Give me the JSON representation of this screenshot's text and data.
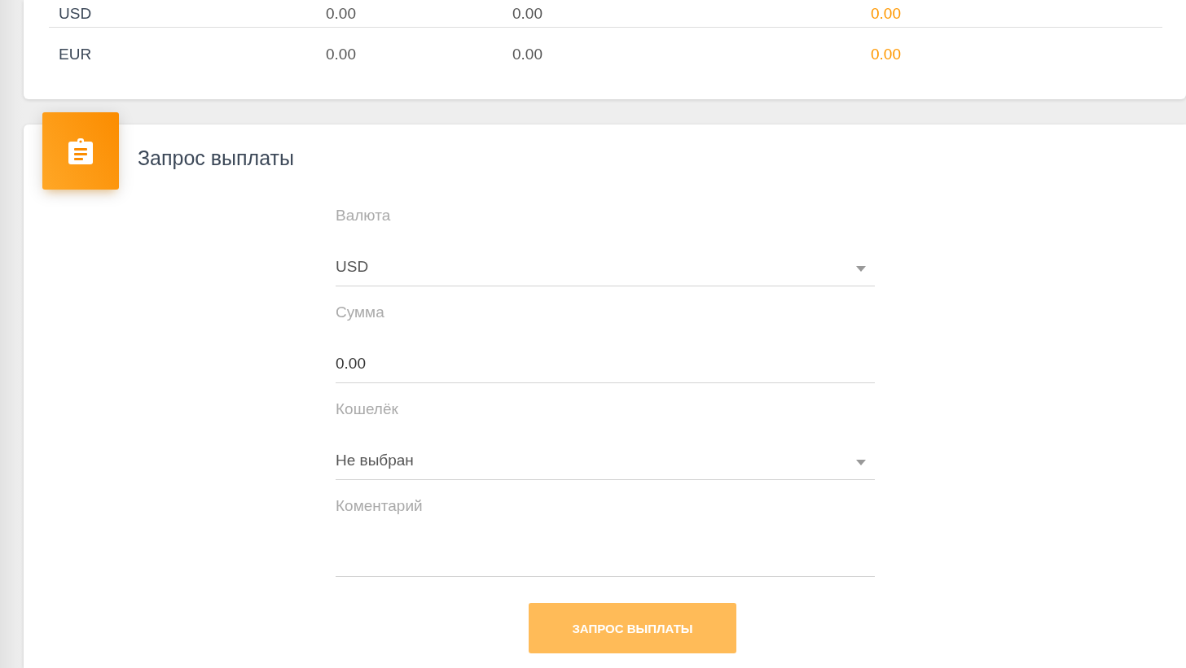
{
  "balances_table": {
    "rows": [
      {
        "cells": [
          "USD",
          "0.00",
          "0.00",
          "0.00"
        ]
      },
      {
        "cells": [
          "EUR",
          "0.00",
          "0.00",
          "0.00"
        ]
      }
    ]
  },
  "payout_request": {
    "title": "Запрос выплаты",
    "fields": [
      {
        "kind": "select",
        "label": "Валюта",
        "value": "USD"
      },
      {
        "kind": "input",
        "label": "Сумма",
        "value": "0.00"
      },
      {
        "kind": "select",
        "label": "Кошелёк",
        "value": "Не выбран"
      },
      {
        "kind": "textarea",
        "label": "Коментарий"
      }
    ],
    "submit": {
      "label": "ЗАПРОС ВЫПЛАТЫ",
      "disabled": true
    }
  }
}
